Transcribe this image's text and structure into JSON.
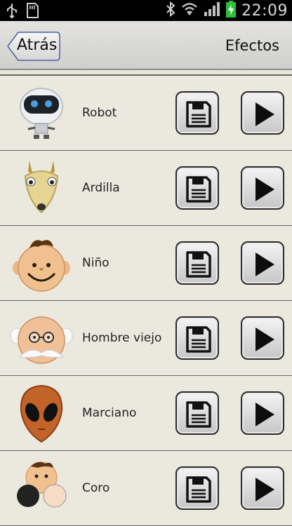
{
  "status_bar": {
    "time": "22:09",
    "icons": [
      "usb-icon",
      "sd-card-icon",
      "bluetooth-icon",
      "wifi-icon",
      "signal-icon",
      "battery-charging-icon"
    ]
  },
  "header": {
    "back_label": "Atrás",
    "title": "Efectos"
  },
  "effects": [
    {
      "label": "Robot",
      "icon": "robot-face-icon"
    },
    {
      "label": "Ardilla",
      "icon": "squirrel-face-icon"
    },
    {
      "label": "Niño",
      "icon": "boy-face-icon"
    },
    {
      "label": "Hombre viejo",
      "icon": "old-man-face-icon"
    },
    {
      "label": "Marciano",
      "icon": "alien-face-icon"
    },
    {
      "label": "Coro",
      "icon": "choir-faces-icon"
    }
  ],
  "buttons": {
    "save_icon": "floppy-disk-icon",
    "play_icon": "play-icon"
  }
}
